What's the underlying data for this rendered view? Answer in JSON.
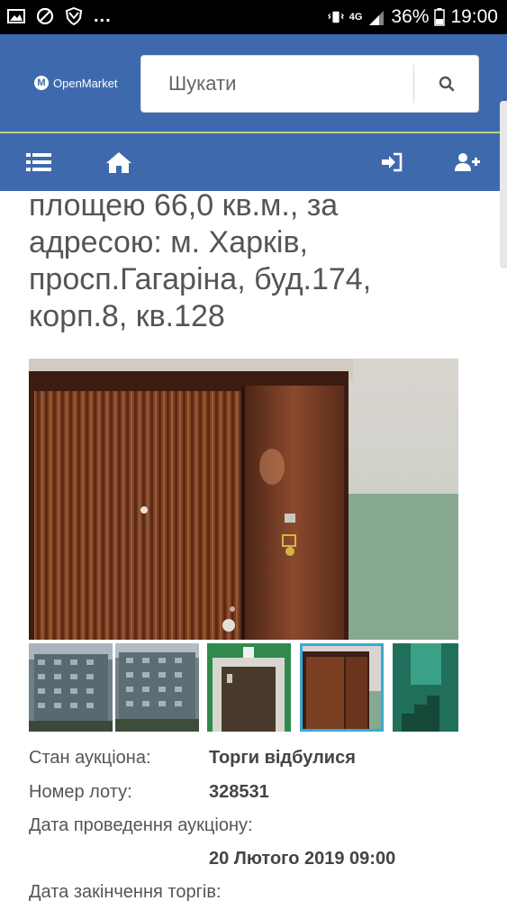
{
  "status_bar": {
    "battery": "36%",
    "time": "19:00",
    "network": "4G",
    "dots": "..."
  },
  "header": {
    "logo_text": "OpenMarket",
    "search_placeholder": "Шукати"
  },
  "navbar": {
    "icons": [
      "list-icon",
      "home-icon",
      "sign-in-icon",
      "user-plus-icon"
    ]
  },
  "title_lines": [
    "площею 66,0 кв.м., за",
    "адресою: м. Харків,",
    "просп.Гагаріна, буд.174,",
    "корп.8, кв.128"
  ],
  "gallery": {
    "selected_index": 3,
    "thumb_count": 5
  },
  "details": [
    {
      "label": "Стан аукціона:",
      "value": "Торги відбулися"
    },
    {
      "label": "Номер лоту:",
      "value": "328531"
    },
    {
      "label": "Дата проведення аукціону:",
      "value": "20 Лютого 2019 09:00"
    },
    {
      "label": "Дата закінчення торгів:",
      "value": ""
    }
  ],
  "colors": {
    "header": "#3e6aad",
    "accent_line": "#b9d27a",
    "thumb_selected": "#39a9d6"
  }
}
